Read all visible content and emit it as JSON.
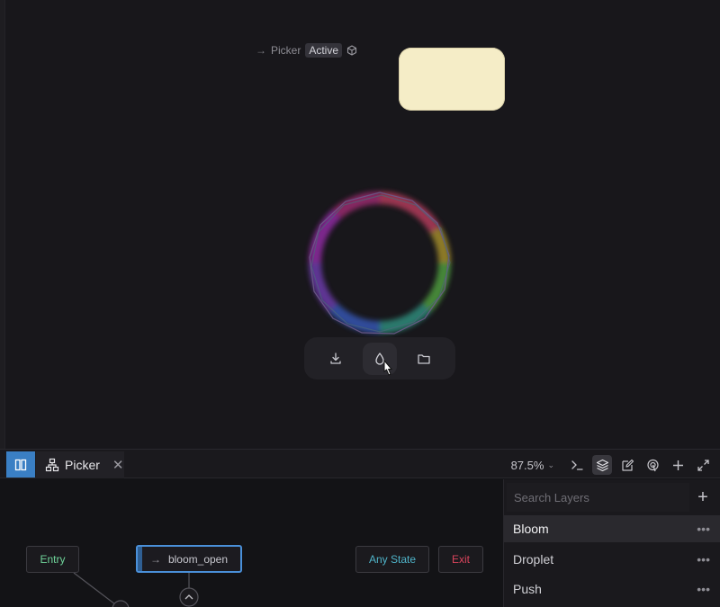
{
  "canvas": {
    "artboard_label": "Picker",
    "artboard_badge": "Active",
    "swatch_color": "#f5edc7"
  },
  "toolbar": {
    "tools": [
      "download-icon",
      "droplet-icon",
      "folder-icon"
    ],
    "active_tool": "droplet-icon"
  },
  "bottom": {
    "tab_label": "Picker",
    "zoom": "87.5%",
    "accent": "#3a7fc4"
  },
  "graph": {
    "entry_label": "Entry",
    "state_label": "bloom_open",
    "any_state_label": "Any State",
    "exit_label": "Exit",
    "colors": {
      "entry": "#6fd49a",
      "any_state": "#4fb3c8",
      "exit": "#d8445c",
      "selected": "#4a90d9"
    }
  },
  "layers": {
    "search_placeholder": "Search Layers",
    "items": [
      {
        "label": "Bloom",
        "selected": true
      },
      {
        "label": "Droplet",
        "selected": false
      },
      {
        "label": "Push",
        "selected": false
      }
    ]
  }
}
